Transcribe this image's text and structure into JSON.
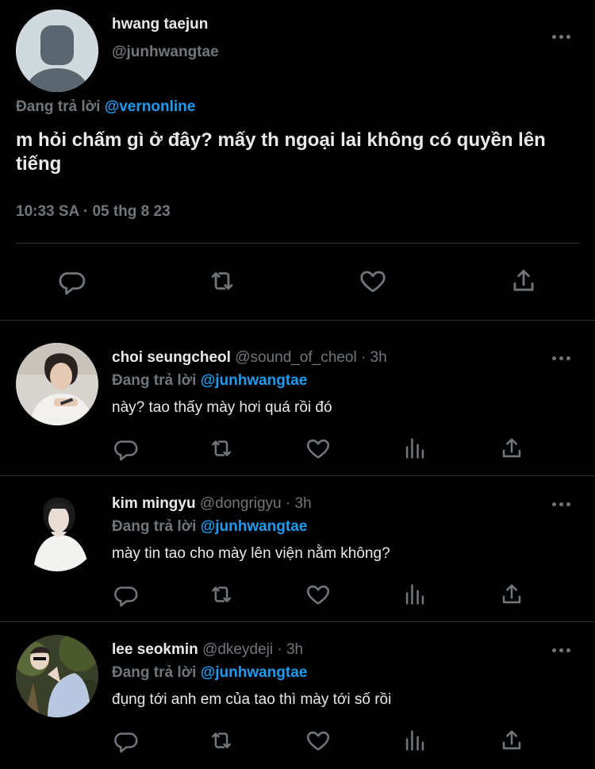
{
  "main_tweet": {
    "display_name": "hwang taejun",
    "handle": "@junhwangtae",
    "replying_prefix": "Đang trả lời",
    "replying_to": "@vernonline",
    "text": "m hỏi chấm gì ở đây? mấy th ngoại lai không có quyền lên tiếng",
    "timestamp": "10:33 SA · 05 thg 8 23"
  },
  "replies": [
    {
      "display_name": "choi seungcheol",
      "handle": "@sound_of_cheol",
      "time": "· 3h",
      "replying_prefix": "Đang trả lời",
      "replying_to": "@junhwangtae",
      "text": "này? tao thấy mày hơi quá rồi đó"
    },
    {
      "display_name": "kim mingyu",
      "handle": "@dongrigyu",
      "time": "· 3h",
      "replying_prefix": "Đang trả lời",
      "replying_to": "@junhwangtae",
      "text": "mày tin tao cho mày lên viện nằm không?"
    },
    {
      "display_name": "lee seokmin",
      "handle": "@dkeydeji",
      "time": "· 3h",
      "replying_prefix": "Đang trả lời",
      "replying_to": "@junhwangtae",
      "text": "đụng tới anh em của tao thì mày tới số rồi"
    }
  ],
  "icons": {
    "reply": "reply-icon",
    "retweet": "retweet-icon",
    "like": "heart-icon",
    "views": "analytics-icon",
    "share": "share-icon",
    "more": "more-icon"
  },
  "colors": {
    "background": "#000000",
    "text": "#e7e9ea",
    "muted": "#71767b",
    "link": "#1d9bf0",
    "divider": "#2f3336"
  }
}
